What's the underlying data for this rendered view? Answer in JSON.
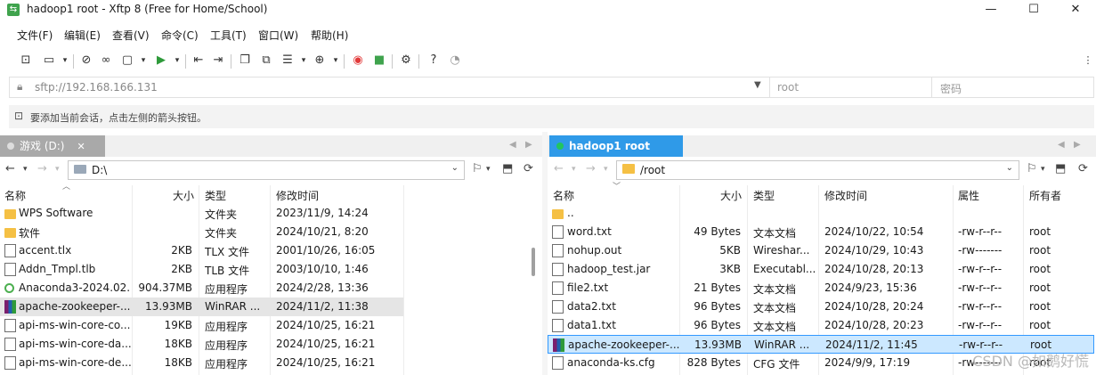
{
  "window": {
    "title": "hadoop1 root - Xftp 8 (Free for Home/School)",
    "minimize": "—",
    "maximize": "☐",
    "close": "✕"
  },
  "menu": [
    "文件(F)",
    "编辑(E)",
    "查看(V)",
    "命令(C)",
    "工具(T)",
    "窗口(W)",
    "帮助(H)"
  ],
  "address": {
    "url_placeholder": "sftp://192.168.166.131",
    "user_placeholder": "root",
    "password_placeholder": "密码"
  },
  "hint": "要添加当前会话，点击左侧的箭头按钮。",
  "left": {
    "tab_label": "游戏 (D:)",
    "path": "D:\\",
    "headers": {
      "name": "名称",
      "size": "大小",
      "type": "类型",
      "modified": "修改时间"
    },
    "rows": [
      {
        "icon": "folder",
        "name": "WPS Software",
        "size": "",
        "type": "文件夹",
        "modified": "2023/11/9, 14:24"
      },
      {
        "icon": "folder",
        "name": "软件",
        "size": "",
        "type": "文件夹",
        "modified": "2024/10/21, 8:20"
      },
      {
        "icon": "doc",
        "name": "accent.tlx",
        "size": "2KB",
        "type": "TLX 文件",
        "modified": "2001/10/26, 16:05"
      },
      {
        "icon": "doc",
        "name": "Addn_Tmpl.tlb",
        "size": "2KB",
        "type": "TLB 文件",
        "modified": "2003/10/10, 1:46"
      },
      {
        "icon": "exe",
        "name": "Anaconda3-2024.02...",
        "size": "904.37MB",
        "type": "应用程序",
        "modified": "2024/2/28, 13:36"
      },
      {
        "icon": "rar",
        "name": "apache-zookeeper-...",
        "size": "13.93MB",
        "type": "WinRAR ...",
        "modified": "2024/11/2, 11:38"
      },
      {
        "icon": "doc",
        "name": "api-ms-win-core-co...",
        "size": "19KB",
        "type": "应用程序",
        "modified": "2024/10/25, 16:21"
      },
      {
        "icon": "doc",
        "name": "api-ms-win-core-da...",
        "size": "18KB",
        "type": "应用程序",
        "modified": "2024/10/25, 16:21"
      },
      {
        "icon": "doc",
        "name": "api-ms-win-core-de...",
        "size": "18KB",
        "type": "应用程序",
        "modified": "2024/10/25, 16:21"
      }
    ]
  },
  "right": {
    "tab_label": "hadoop1 root",
    "path": "/root",
    "headers": {
      "name": "名称",
      "size": "大小",
      "type": "类型",
      "modified": "修改时间",
      "perm": "属性",
      "owner": "所有者"
    },
    "rows": [
      {
        "icon": "folder",
        "name": "..",
        "size": "",
        "type": "",
        "modified": "",
        "perm": "",
        "owner": ""
      },
      {
        "icon": "doc",
        "name": "word.txt",
        "size": "49 Bytes",
        "type": "文本文档",
        "modified": "2024/10/22, 10:54",
        "perm": "-rw-r--r--",
        "owner": "root"
      },
      {
        "icon": "doc",
        "name": "nohup.out",
        "size": "5KB",
        "type": "Wireshar...",
        "modified": "2024/10/29, 10:43",
        "perm": "-rw-------",
        "owner": "root"
      },
      {
        "icon": "doc",
        "name": "hadoop_test.jar",
        "size": "3KB",
        "type": "Executabl...",
        "modified": "2024/10/28, 20:13",
        "perm": "-rw-r--r--",
        "owner": "root"
      },
      {
        "icon": "doc",
        "name": "file2.txt",
        "size": "21 Bytes",
        "type": "文本文档",
        "modified": "2024/9/23, 15:36",
        "perm": "-rw-r--r--",
        "owner": "root"
      },
      {
        "icon": "doc",
        "name": "data2.txt",
        "size": "96 Bytes",
        "type": "文本文档",
        "modified": "2024/10/28, 20:24",
        "perm": "-rw-r--r--",
        "owner": "root"
      },
      {
        "icon": "doc",
        "name": "data1.txt",
        "size": "96 Bytes",
        "type": "文本文档",
        "modified": "2024/10/28, 20:23",
        "perm": "-rw-r--r--",
        "owner": "root"
      },
      {
        "icon": "rar",
        "name": "apache-zookeeper-...",
        "size": "13.93MB",
        "type": "WinRAR ...",
        "modified": "2024/11/2, 11:45",
        "perm": "-rw-r--r--",
        "owner": "root"
      },
      {
        "icon": "doc",
        "name": "anaconda-ks.cfg",
        "size": "828 Bytes",
        "type": "CFG 文件",
        "modified": "2024/9/9, 17:19",
        "perm": "-rw-------",
        "owner": "root"
      }
    ]
  },
  "watermark": "CSDN @如鹅好慌",
  "colors": {
    "active_tab": "#2f9ae8",
    "online_dot": "#22c55e",
    "selection": "#cce8ff"
  }
}
